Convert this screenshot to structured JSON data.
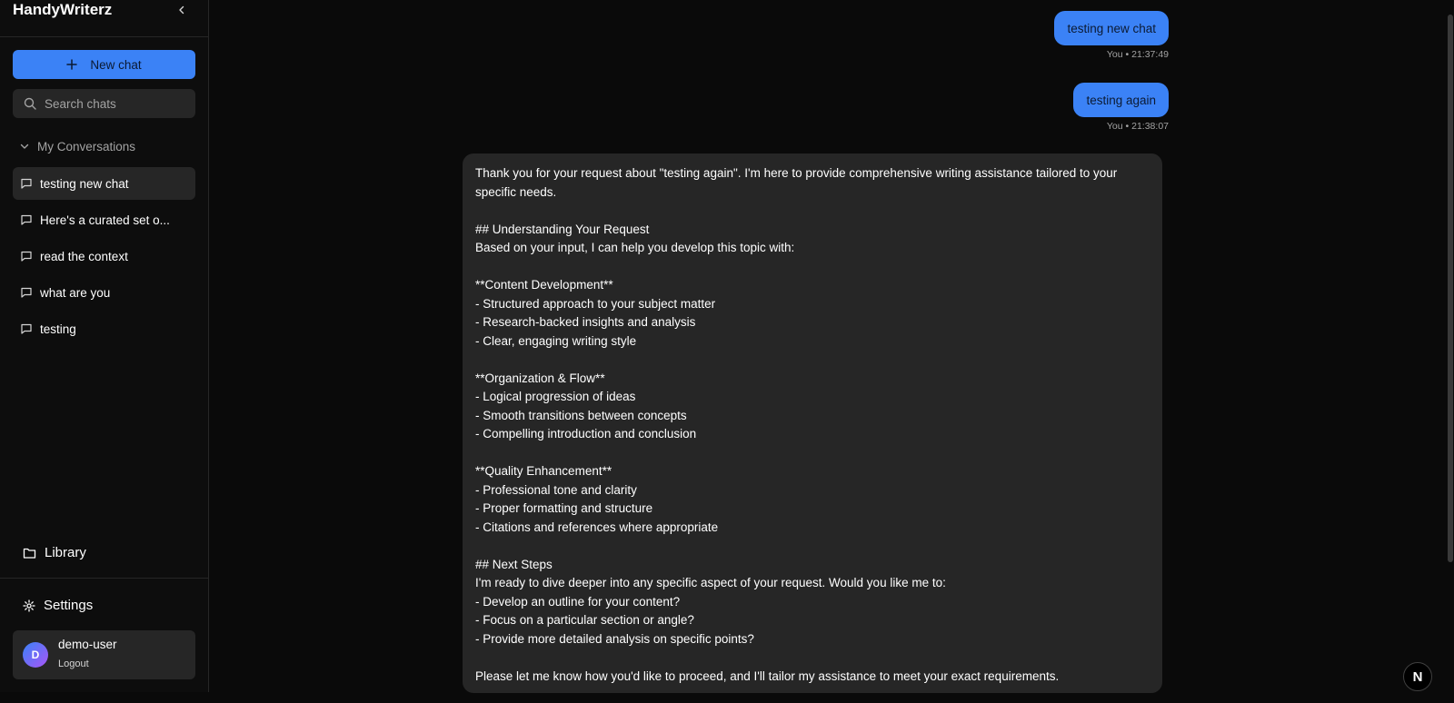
{
  "app": {
    "title": "HandyWriterz"
  },
  "sidebar": {
    "new_chat_label": "New chat",
    "search_placeholder": "Search chats",
    "section_label": "My Conversations",
    "conversations": [
      {
        "label": "testing new chat",
        "active": true
      },
      {
        "label": "Here's a curated set o..."
      },
      {
        "label": "read the context"
      },
      {
        "label": "what are you"
      },
      {
        "label": "testing"
      }
    ],
    "library_label": "Library",
    "settings_label": "Settings",
    "user": {
      "initial": "D",
      "name": "demo-user",
      "logout_label": "Logout"
    }
  },
  "chat": {
    "messages": [
      {
        "role": "user",
        "text": "testing new chat",
        "meta": "You • 21:37:49"
      },
      {
        "role": "user",
        "text": "testing again",
        "meta": "You • 21:38:07"
      },
      {
        "role": "assistant",
        "text": "Thank you for your request about \"testing again\". I'm here to provide comprehensive writing assistance tailored to your specific needs.\n\n## Understanding Your Request\nBased on your input, I can help you develop this topic with:\n\n**Content Development**\n- Structured approach to your subject matter\n- Research-backed insights and analysis\n- Clear, engaging writing style\n\n**Organization & Flow**\n- Logical progression of ideas\n- Smooth transitions between concepts\n- Compelling introduction and conclusion\n\n**Quality Enhancement**\n- Professional tone and clarity\n- Proper formatting and structure\n- Citations and references where appropriate\n\n## Next Steps\nI'm ready to dive deeper into any specific aspect of your request. Would you like me to:\n- Develop an outline for your content?\n- Focus on a particular section or angle?\n- Provide more detailed analysis on specific points?\n\nPlease let me know how you'd like to proceed, and I'll tailor my assistance to meet your exact requirements."
      }
    ]
  },
  "badge": {
    "label": "N"
  },
  "colors": {
    "accent": "#3b82f6",
    "surface": "#262626",
    "background": "#0a0a0a"
  }
}
